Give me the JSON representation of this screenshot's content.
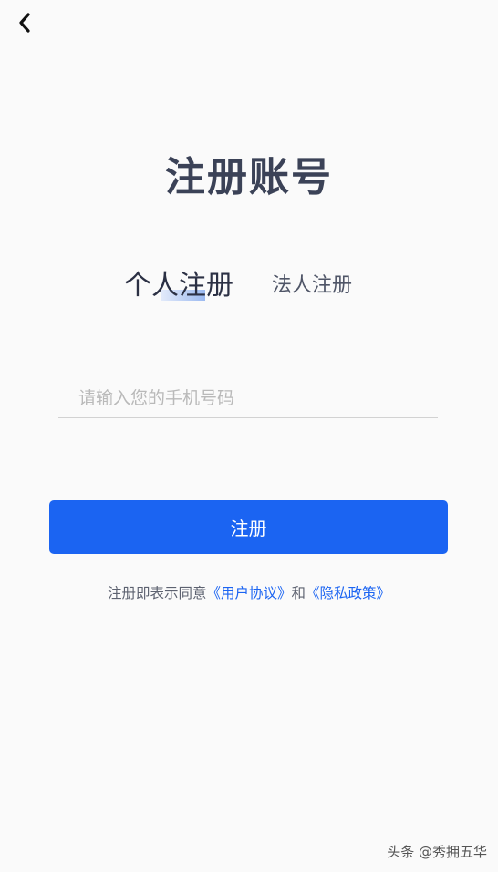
{
  "header": {
    "back_icon": "chevron-left-icon"
  },
  "title": "注册账号",
  "tabs": [
    {
      "label": "个人注册",
      "active": true
    },
    {
      "label": "法人注册",
      "active": false
    }
  ],
  "phone_field": {
    "placeholder": "请输入您的手机号码",
    "value": ""
  },
  "register_button": {
    "label": "注册"
  },
  "agreement": {
    "prefix": "注册即表示同意",
    "user_agreement": "《用户协议》",
    "conjunction": "和",
    "privacy_policy": "《隐私政策》"
  },
  "watermark": "头条 @秀拥五华",
  "colors": {
    "primary": "#1b64f2",
    "title": "#3b4257",
    "background": "#fafafa"
  }
}
